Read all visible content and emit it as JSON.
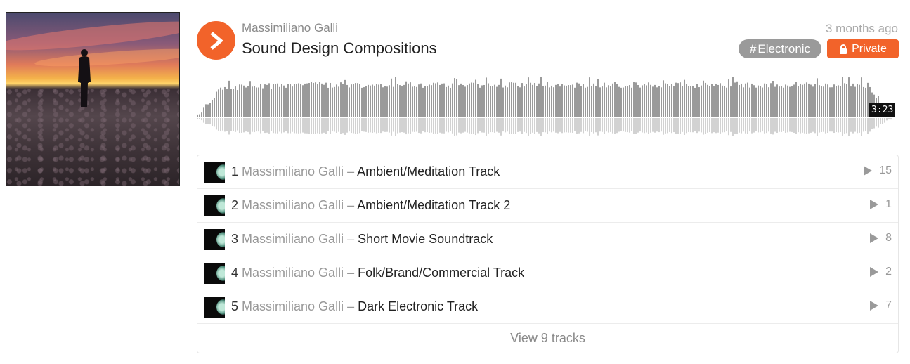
{
  "header": {
    "user": "Massimiliano Galli",
    "title": "Sound Design Compositions",
    "time_ago": "3 months ago",
    "tag": "Electronic",
    "tag_prefix": "#",
    "private_label": "Private",
    "duration": "3:23"
  },
  "colors": {
    "accent": "#f2632a",
    "tag_bg": "#9a9a9a",
    "wave_top": "#9a9a9a",
    "wave_bottom": "#d2d2d2"
  },
  "tracks": [
    {
      "num": "1",
      "artist": "Massimiliano Galli",
      "sep": "–",
      "title": "Ambient/Meditation Track",
      "plays": "15"
    },
    {
      "num": "2",
      "artist": "Massimiliano Galli",
      "sep": "–",
      "title": "Ambient/Meditation Track 2",
      "plays": "1"
    },
    {
      "num": "3",
      "artist": "Massimiliano Galli",
      "sep": "–",
      "title": "Short Movie Soundtrack",
      "plays": "8"
    },
    {
      "num": "4",
      "artist": "Massimiliano Galli",
      "sep": "–",
      "title": "Folk/Brand/Commercial Track",
      "plays": "2"
    },
    {
      "num": "5",
      "artist": "Massimiliano Galli",
      "sep": "–",
      "title": "Dark Electronic Track",
      "plays": "7"
    }
  ],
  "view_all": "View 9 tracks",
  "icons": {
    "play": "play-icon",
    "lock": "lock-icon",
    "track_play": "play-count-icon"
  }
}
